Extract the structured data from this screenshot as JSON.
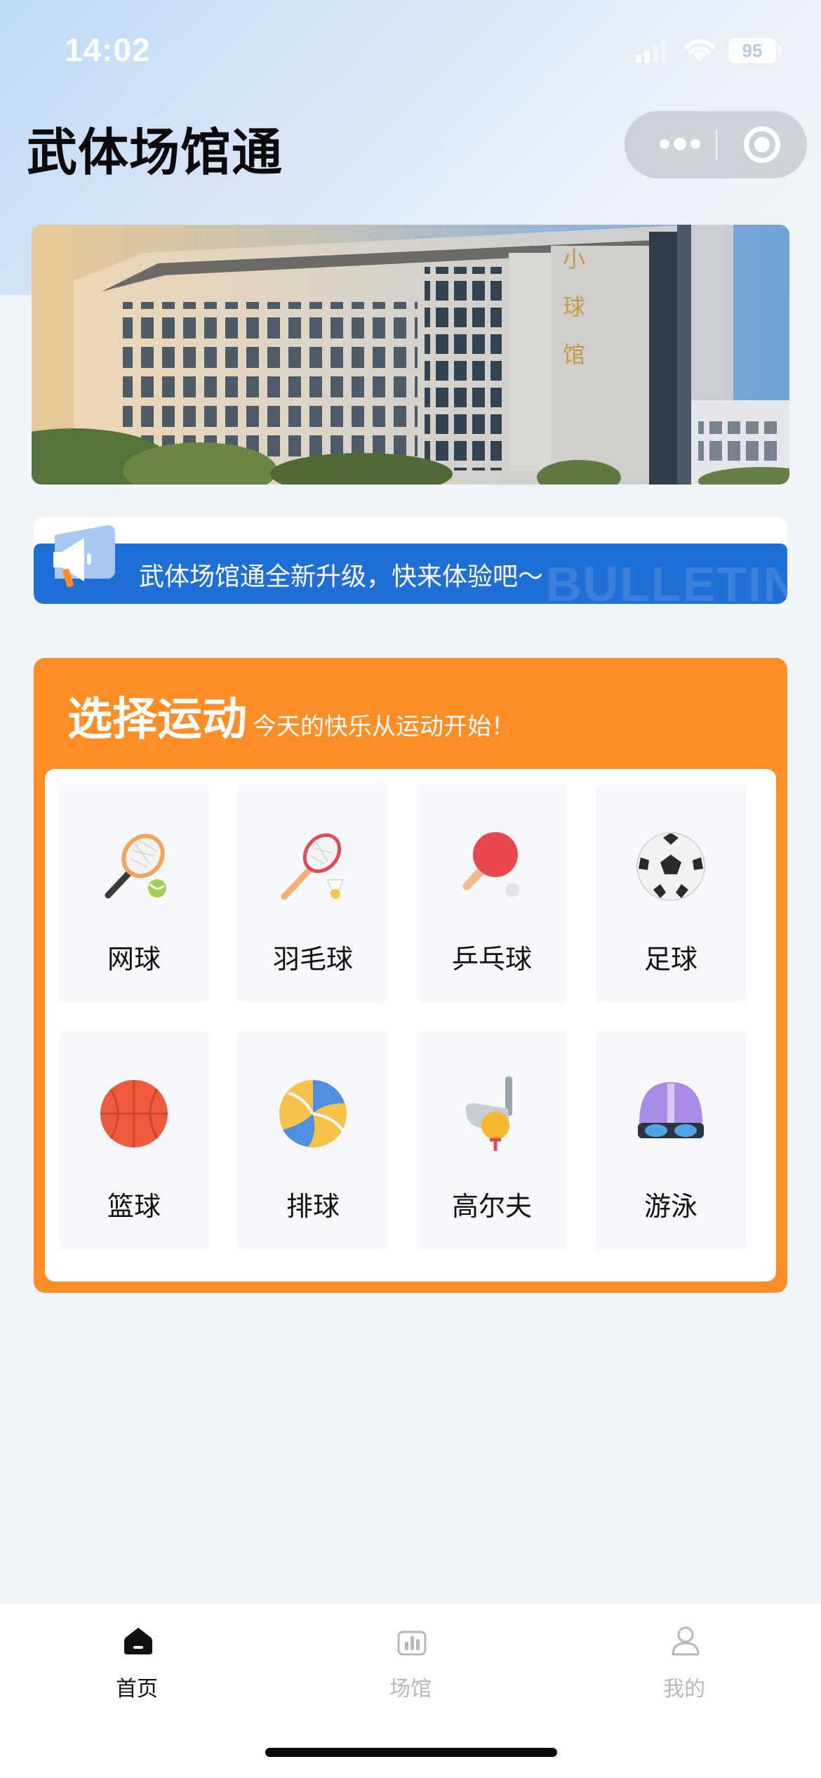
{
  "status_bar": {
    "time": "14:02",
    "battery": "95"
  },
  "header": {
    "title": "武体场馆通"
  },
  "banner": {
    "building_sign": [
      "小",
      "球",
      "馆"
    ]
  },
  "bulletin": {
    "text": "武体场馆通全新升级，快来体验吧～",
    "watermark": "BULLETIN"
  },
  "sports": {
    "title": "选择运动",
    "subtitle": "今天的快乐从运动开始！",
    "items": [
      {
        "label": "网球",
        "icon": "tennis-icon"
      },
      {
        "label": "羽毛球",
        "icon": "badminton-icon"
      },
      {
        "label": "乒乓球",
        "icon": "table-tennis-icon"
      },
      {
        "label": "足球",
        "icon": "football-icon"
      },
      {
        "label": "篮球",
        "icon": "basketball-icon"
      },
      {
        "label": "排球",
        "icon": "volleyball-icon"
      },
      {
        "label": "高尔夫",
        "icon": "golf-icon"
      },
      {
        "label": "游泳",
        "icon": "swimming-icon"
      }
    ]
  },
  "tabbar": {
    "items": [
      {
        "label": "首页",
        "icon": "home-icon",
        "active": true
      },
      {
        "label": "场馆",
        "icon": "venue-icon",
        "active": false
      },
      {
        "label": "我的",
        "icon": "profile-icon",
        "active": false
      }
    ],
    "active_color": "#111111",
    "inactive_color": "#B8B8B8"
  },
  "colors": {
    "accent_orange": "#FF8E27",
    "bulletin_blue": "#1E6FD6",
    "background": "#F1F4F8"
  }
}
